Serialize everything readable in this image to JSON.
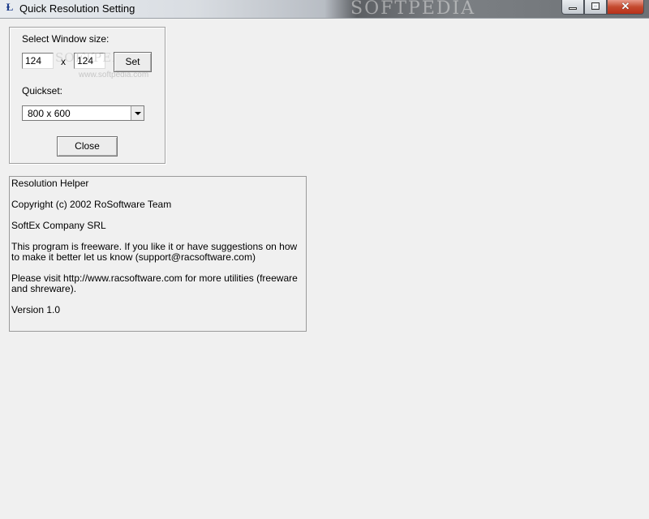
{
  "window": {
    "title": "Quick Resolution Setting",
    "app_icon": "ruler-icon",
    "watermark": "SOFTPEDIA"
  },
  "controls": {
    "select_label": "Select Window size:",
    "width_value": "124",
    "separator": "x",
    "height_value": "124",
    "set_label": "Set",
    "quickset_label": "Quickset:",
    "quickset_value": "800 x  600",
    "close_label": "Close",
    "watermark_text": "SOFTPEDIA",
    "watermark_url": "www.softpedia.com"
  },
  "info": {
    "lines": [
      "Resolution Helper",
      "Copyright (c) 2002 RoSoftware Team",
      "SoftEx Company SRL",
      "This program is freeware. If you like it or have suggestions on how to make it better let us know (support@racsoftware.com)",
      "Please visit http://www.racsoftware.com for more utilities (freeware and shreware).",
      "Version 1.0"
    ]
  }
}
